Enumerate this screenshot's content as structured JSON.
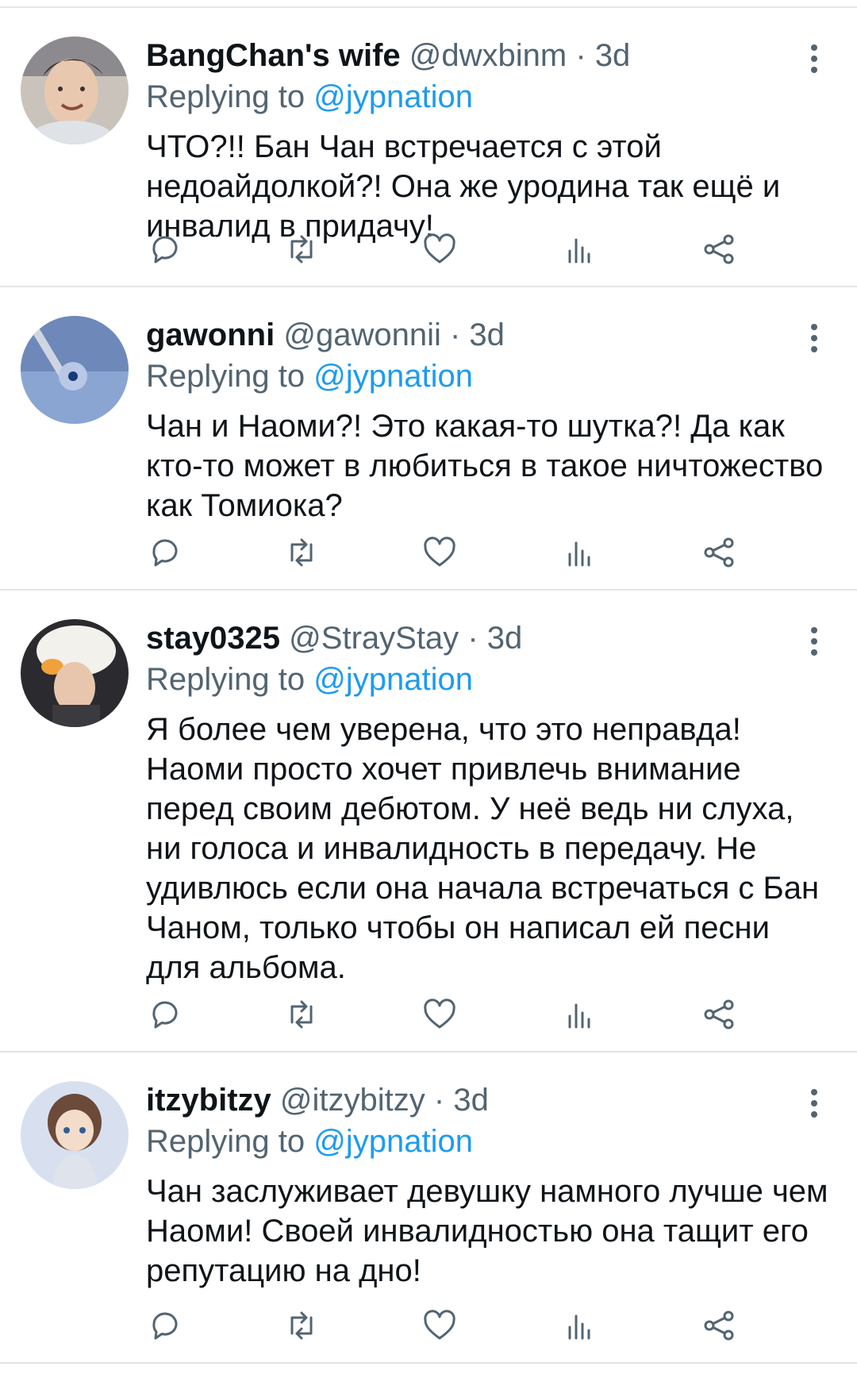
{
  "tweets": [
    {
      "name": "BangChan's wife",
      "handle": "@dwxbinm",
      "time": "3d",
      "replying_prefix": "Replying to",
      "replying_to": "@jypnation",
      "text": "ЧТО?!! Бан Чан встречается с этой недоайдолкой?! Она же уродина так ещё и инвалид в придачу!"
    },
    {
      "name": "gawonni",
      "handle": "@gawonnii",
      "time": "3d",
      "replying_prefix": "Replying to",
      "replying_to": "@jypnation",
      "text": "Чан и Наоми?! Это какая-то шутка?! Да как кто-то может в любиться в такое ничтожество как Томиока?"
    },
    {
      "name": "stay0325",
      "handle": "@StrayStay",
      "time": "3d",
      "replying_prefix": "Replying to",
      "replying_to": "@jypnation",
      "text": "Я более чем уверена, что это неправда! Наоми просто хочет привлечь внимание перед своим дебютом. У неё ведь ни слуха, ни голоса и инвалидность в передачу. Не удивлюсь если она начала встречаться с Бан Чаном, только чтобы он написал ей песни для альбома."
    },
    {
      "name": "itzybitzy",
      "handle": "@itzybitzy",
      "time": "3d",
      "replying_prefix": "Replying to",
      "replying_to": "@jypnation",
      "text": "Чан заслуживает девушку намного лучше чем Наоми! Своей инвалидностью она тащит его репутацию на дно!"
    }
  ],
  "meta_separator": "·",
  "icons": [
    "reply-icon",
    "retweet-icon",
    "like-icon",
    "views-icon",
    "share-icon",
    "more-icon"
  ],
  "colors": {
    "link": "#1d9bf0",
    "muted": "#536471",
    "text": "#0f1419"
  }
}
